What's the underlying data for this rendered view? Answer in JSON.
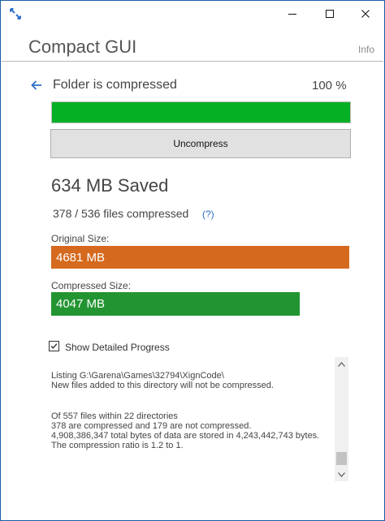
{
  "window": {
    "minimize_glyph": "—",
    "maximize_glyph": "☐",
    "close_glyph": "✕",
    "icon": "compact-app-icon"
  },
  "header": {
    "title": "Compact GUI",
    "info_label": "Info"
  },
  "status": {
    "back_icon": "back-arrow-icon",
    "text": "Folder is compressed",
    "percent": "100 %",
    "progress_fraction": 1.0,
    "progress_color": "#06b025"
  },
  "actions": {
    "uncompress_label": "Uncompress"
  },
  "summary": {
    "saved": "634 MB Saved",
    "files": "378 / 536 files compressed",
    "help": "(?)"
  },
  "sizes": {
    "original_label": "Original Size:",
    "original_value": "4681 MB",
    "original_color": "#d5691e",
    "compressed_label": "Compressed Size:",
    "compressed_value": "4047 MB",
    "compressed_color": "#229431"
  },
  "options": {
    "show_progress_label": "Show Detailed Progress",
    "show_progress_checked": true
  },
  "log": {
    "line1": "Listing G:\\Garena\\Games\\32794\\XignCode\\",
    "line2": "New files added to this directory will not be compressed.",
    "line3": "Of 557 files within 22 directories",
    "line4": "378 are compressed and 179 are not compressed.",
    "line5": "4,908,386,347 total bytes of data are stored in 4,243,442,743 bytes.",
    "line6": "The compression ratio is 1.2 to 1."
  }
}
